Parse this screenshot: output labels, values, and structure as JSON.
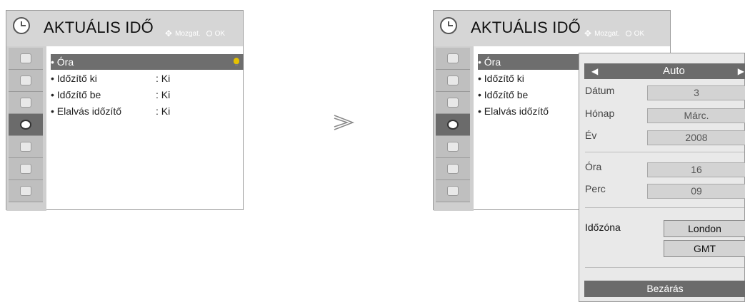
{
  "left_panel": {
    "title": "AKTUÁLIS IDŐ",
    "hint_move": "Mozgat.",
    "hint_ok": "OK",
    "items": [
      {
        "label": "• Óra",
        "value": ""
      },
      {
        "label": "• Időzítő ki",
        "value": ": Ki"
      },
      {
        "label": "• Időzítő be",
        "value": ": Ki"
      },
      {
        "label": "• Elalvás időzítő",
        "value": ": Ki"
      }
    ]
  },
  "right_panel": {
    "title": "AKTUÁLIS IDŐ",
    "hint_move": "Mozgat.",
    "hint_ok": "OK",
    "items": [
      {
        "label": "• Óra"
      },
      {
        "label": "• Időzítő ki"
      },
      {
        "label": "• Időzítő be"
      },
      {
        "label": "• Elalvás időzítő"
      }
    ]
  },
  "popup": {
    "mode": "Auto",
    "date_label": "Dátum",
    "date_value": "3",
    "month_label": "Hónap",
    "month_value": "Márc.",
    "year_label": "Év",
    "year_value": "2008",
    "hour_label": "Óra",
    "hour_value": "16",
    "minute_label": "Perc",
    "minute_value": "09",
    "timezone_label": "Időzóna",
    "timezone_value": "London",
    "timezone_offset": "GMT",
    "close_label": "Bezárás"
  },
  "sidebar_icons": [
    "picture-icon",
    "screen-icon",
    "audio-icon",
    "clock-icon",
    "lock-icon",
    "input-icon",
    "setup-icon"
  ],
  "colors": {
    "selected_bg": "#6b6b6b",
    "panel_bg": "#d6d6d6",
    "field_bg": "#d3d3d3"
  }
}
